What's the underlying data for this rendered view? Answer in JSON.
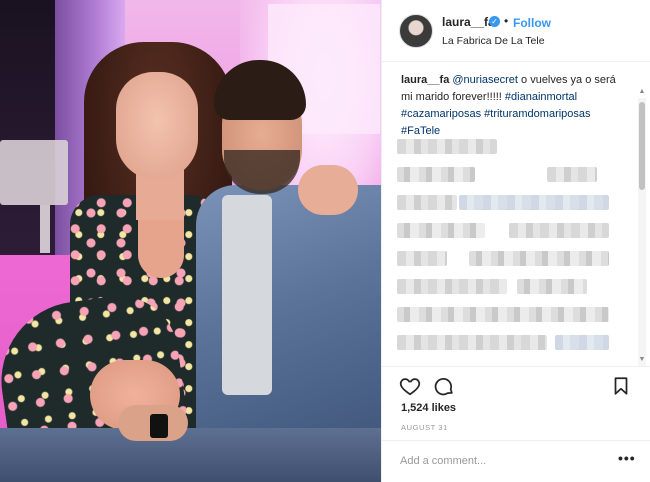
{
  "post": {
    "username": "laura__fa",
    "verified_glyph": "✓",
    "separator": "•",
    "follow_label": "Follow",
    "location": "La Fabrica De La Tele",
    "caption": {
      "username": "laura__fa",
      "mention": "@nuriasecret",
      "text": " o vuelves ya o será mi marido forever!!!!! ",
      "tags": [
        "#dianainmortal",
        "#cazamariposas",
        "#trituramdomariposas",
        "#FaTele"
      ]
    },
    "likes": "1,524 likes",
    "date": "AUGUST 31",
    "comment_placeholder": "Add a comment...",
    "more_label": "•••"
  },
  "icons": {
    "heart": "heart-icon",
    "comment": "comment-icon",
    "bookmark": "bookmark-icon",
    "verified": "verified-badge-icon"
  },
  "colors": {
    "link_blue": "#3897f0",
    "hashtag_blue": "#003569",
    "text": "#262626",
    "muted": "#999999",
    "border": "#efefef"
  }
}
